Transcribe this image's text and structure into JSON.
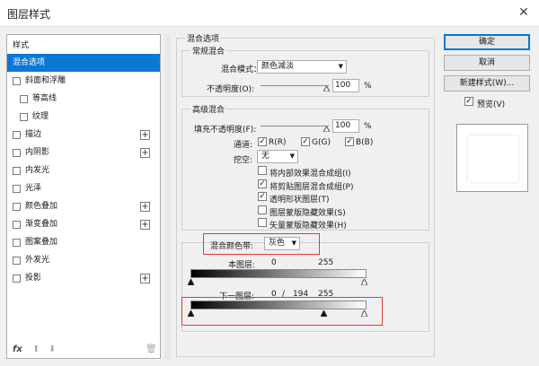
{
  "window": {
    "title": "图层样式",
    "close": "✕"
  },
  "sidebar": {
    "items": [
      {
        "label": "样式"
      },
      {
        "label": "混合选项"
      },
      {
        "label": "斜面和浮雕"
      },
      {
        "label": "等高线"
      },
      {
        "label": "纹理"
      },
      {
        "label": "描边",
        "plus": "+"
      },
      {
        "label": "内阴影",
        "plus": "+"
      },
      {
        "label": "内发光"
      },
      {
        "label": "光泽"
      },
      {
        "label": "颜色叠加",
        "plus": "+"
      },
      {
        "label": "渐变叠加",
        "plus": "+"
      },
      {
        "label": "图案叠加"
      },
      {
        "label": "外发光"
      },
      {
        "label": "投影",
        "plus": "+"
      }
    ],
    "footer": {
      "fx": "fx",
      "up": "⬆",
      "down": "⬇",
      "trash": "🗑"
    }
  },
  "blend_options": {
    "section_title": "混合选项",
    "general": {
      "title": "常规混合",
      "mode_label": "混合模式：",
      "mode_value": "颜色减淡",
      "opacity_label": "不透明度(O):",
      "opacity_value": "100",
      "opacity_unit": "%"
    },
    "advanced": {
      "title": "高级混合",
      "fill_label": "填充不透明度(F):",
      "fill_value": "100",
      "fill_unit": "%",
      "channels_label": "通道:",
      "ch_r": "R(R)",
      "ch_g": "G(G)",
      "ch_b": "B(B)",
      "knockout_label": "挖空:",
      "knockout_value": "无",
      "opt1": "将内部效果混合成组(I)",
      "opt2": "将剪贴图层混合成组(P)",
      "opt3": "透明形状图层(T)",
      "opt4": "图层蒙版隐藏效果(S)",
      "opt5": "矢量蒙版隐藏效果(H)"
    },
    "blend_if": {
      "label": "混合颜色带:",
      "value": "灰色",
      "this_layer_label": "本图层:",
      "this_layer_low": "0",
      "this_layer_high": "255",
      "under_layer_label": "下一图层:",
      "under_low": "0",
      "under_sep": "/",
      "under_mid": "194",
      "under_high": "255"
    }
  },
  "checks": {
    "mark": "✓"
  },
  "buttons": {
    "ok": "确定",
    "cancel": "取消",
    "new_style": "新建样式(W)...",
    "preview": "预览(V)"
  },
  "colors": {
    "selected": "#0c78d6",
    "highlight": "#e53935"
  }
}
